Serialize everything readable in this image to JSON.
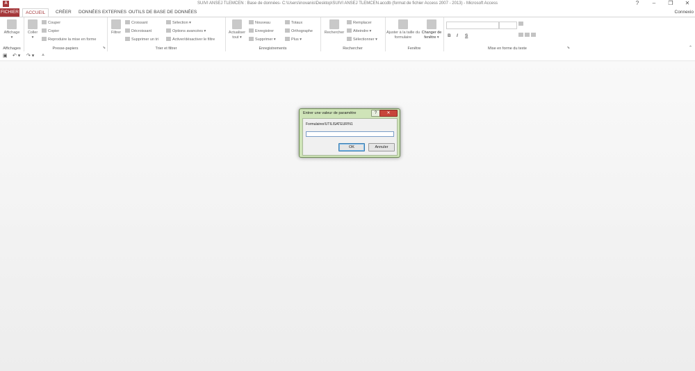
{
  "window": {
    "app_icon": "A",
    "title": "SUIVI ANSEJ TLEMCEN : Base de données- C:\\Users\\inovanis\\Desktop\\SUIVI ANSEJ TLEMCEN.accdb (format de fichier Access 2007 - 2013) - Microsoft Access",
    "help": "?",
    "minimize": "–",
    "restore": "❐",
    "close": "✕"
  },
  "tabs": {
    "file": "FICHIER",
    "home": "ACCUEIL",
    "create": "CRÉER",
    "external": "DONNÉES EXTERNES",
    "db_tools": "OUTILS DE BASE DE DONNÉES"
  },
  "user": "Connexio",
  "ribbon": {
    "views": {
      "view": "Affichage",
      "label": "Affichages"
    },
    "clipboard": {
      "paste": "Coller",
      "cut": "Couper",
      "copy": "Copier",
      "format_painter": "Reproduire la mise en forme",
      "label": "Presse-papiers"
    },
    "sort_filter": {
      "filter": "Filtrer",
      "ascending": "Croissant",
      "descending": "Décroissant",
      "remove_sort": "Supprimer un tri",
      "selection": "Sélection",
      "advanced": "Options avancées",
      "toggle_filter": "Activer/désactiver le filtre",
      "label": "Trier et filtrer"
    },
    "records": {
      "refresh": "Actualiser tout",
      "new": "Nouveau",
      "save": "Enregistrer",
      "delete": "Supprimer",
      "totals": "Totaux",
      "spelling": "Orthographe",
      "more": "Plus",
      "label": "Enregistrements"
    },
    "find": {
      "find": "Rechercher",
      "replace": "Remplacer",
      "goto": "Atteindre",
      "select": "Sélectionner",
      "label": "Rechercher"
    },
    "window": {
      "fit": "Ajuster à la taille du formulaire",
      "switch": "Changer de fenêtre",
      "label": "Fenêtre"
    },
    "text_format": {
      "bold": "B",
      "italic": "I",
      "underline": "S",
      "label": "Mise en forme du texte"
    }
  },
  "dialog": {
    "title": "Entrer une valeur de paramètre",
    "help": "?",
    "close": "✕",
    "prompt": "Formulaires!UTILISATEUR!N1",
    "input_value": "",
    "ok": "OK",
    "cancel": "Annuler"
  }
}
